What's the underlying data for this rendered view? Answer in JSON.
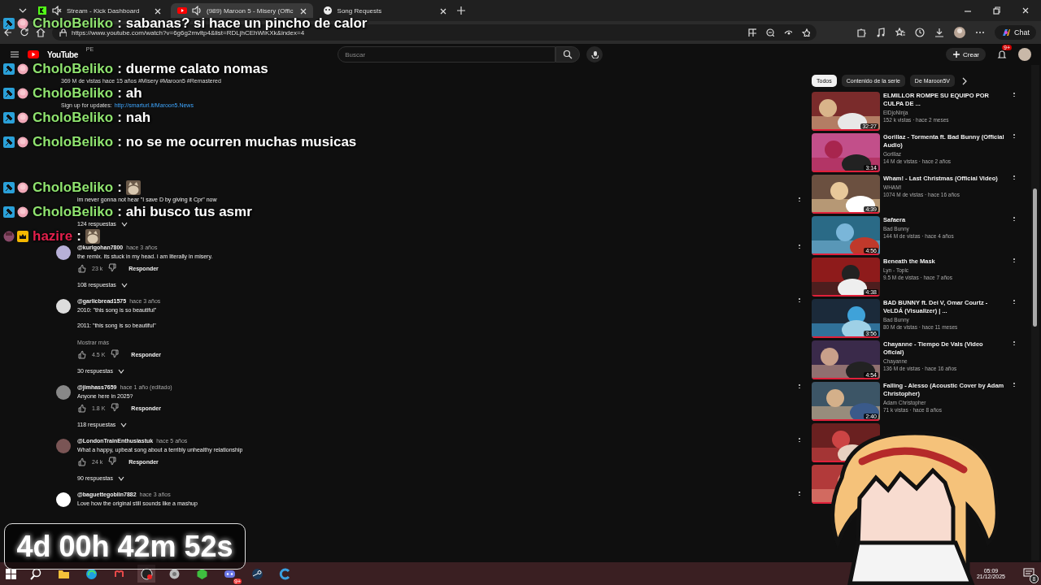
{
  "browser": {
    "tabs": [
      {
        "title": "Stream - Kick Dashboard",
        "kind": "kick",
        "audible": true,
        "muted": true,
        "selected": false
      },
      {
        "title": "(989) Maroon 5 - Misery (Offic",
        "kind": "youtube",
        "audible": true,
        "muted": false,
        "selected": true
      },
      {
        "title": "Song Requests",
        "kind": "bot",
        "audible": false,
        "selected": false
      }
    ],
    "url": "https://www.youtube.com/watch?v=6g6g2mvltp4&list=RDLjhCEhWiKXk&index=4",
    "chat_button": "Chat"
  },
  "youtube": {
    "logo": "YouTube",
    "region": "PE",
    "search_placeholder": "Buscar",
    "create": "Crear",
    "notifications": "9+",
    "description": {
      "meta": "369 M de vistas  hace 15 años  #Misery #Maroon5 #Remastered",
      "signup": "Sign up for updates:",
      "link": "http://smarturl.it/Maroon5.News"
    },
    "comments": [
      {
        "lines": [
          "im never gonna not hear \"I save D by giving it Cpr\" now"
        ],
        "replies": "124 respuestas"
      },
      {
        "author": "@kurigohan7800",
        "time": "hace 3 años",
        "lines": [
          "the remix. its stuck in my head. i am literally in misery."
        ],
        "likes": "23 k",
        "reply": "Responder",
        "replies": "108 respuestas"
      },
      {
        "author": "@garlicbread1575",
        "time": "hace 3 años",
        "lines": [
          "2010: \"this song is so beautiful\"",
          "2011: \"this song is so beautiful\""
        ],
        "more": "Mostrar más",
        "likes": "4.5 K",
        "reply": "Responder",
        "replies": "30 respuestas"
      },
      {
        "author": "@jimhass7659",
        "time": "hace 1 año (editado)",
        "lines": [
          "Anyone here in 2025?"
        ],
        "likes": "1.8 K",
        "reply": "Responder",
        "replies": "118 respuestas"
      },
      {
        "author": "@LondonTrainEnthusiastuk",
        "time": "hace 5 años",
        "lines": [
          "What a happy, upbeat song about a terribly unhealthy relationship"
        ],
        "likes": "24 k",
        "reply": "Responder",
        "replies": "90 respuestas"
      },
      {
        "author": "@baguettegoblin7882",
        "time": "hace 3 años",
        "lines": [
          "Love how the original still sounds like a mashup"
        ]
      }
    ],
    "chips": [
      {
        "label": "Todos",
        "selected": true
      },
      {
        "label": "Contenido de la serie",
        "selected": false
      },
      {
        "label": "De Maroon5V",
        "selected": false
      }
    ],
    "videos": [
      {
        "kind": "video",
        "title": "ELMILLOR ROMPE SU EQUIPO POR CULPA DE ...",
        "channel": "ElDjoNinja",
        "stats": "152 k vistas · hace 2 meses",
        "duration": "32:27"
      },
      {
        "kind": "video",
        "title": "Gorillaz - Tormenta ft. Bad Bunny (Official Audio)",
        "channel": "Gorillaz",
        "stats": "14 M de vistas · hace 2 años",
        "duration": "3:14"
      },
      {
        "kind": "video",
        "title": "Wham! - Last Christmas (Official Video)",
        "channel": "WHAM!",
        "stats": "1074 M de vistas · hace 16 años",
        "duration": "4:39"
      },
      {
        "kind": "video",
        "title": "Safaera",
        "channel": "Bad Bunny",
        "stats": "144 M de vistas · hace 4 años",
        "duration": "4:56"
      },
      {
        "kind": "video",
        "title": "Beneath the Mask",
        "channel": "Lyn - Topic",
        "stats": "9.5 M de vistas · hace 7 años",
        "duration": "4:38"
      },
      {
        "kind": "video",
        "title": "BAD BUNNY ft. Dei V, Omar Courtz - VeLDÁ (Visualizer) | ...",
        "channel": "Bad Bunny",
        "stats": "80 M de vistas · hace 11 meses",
        "duration": "3:56"
      },
      {
        "kind": "video",
        "title": "Chayanne - Tiempo De Vals (Video Oficial)",
        "channel": "Chayanne",
        "stats": "136 M de vistas · hace 16 años",
        "duration": "4:54"
      },
      {
        "kind": "video",
        "title": "Falling - Alesso (Acoustic Cover by Adam Christopher)",
        "channel": "Adam Christopher",
        "stats": "71 k vistas · hace 8 años",
        "duration": "2:40"
      },
      {
        "kind": "thumbnail"
      },
      {
        "kind": "thumbnail"
      }
    ]
  },
  "chat": [
    {
      "user": "CholoBeliko",
      "color": "#8fe36f",
      "moderator": true,
      "crown": false,
      "separator": ":",
      "message": "sabanas? si hace un pincho de calor"
    },
    {
      "user": "CholoBeliko",
      "color": "#8fe36f",
      "moderator": true,
      "crown": false,
      "separator": ":",
      "message": "duerme calato nomas"
    },
    {
      "user": "CholoBeliko",
      "color": "#8fe36f",
      "moderator": true,
      "crown": false,
      "separator": ":",
      "message": "ah"
    },
    {
      "user": "CholoBeliko",
      "color": "#8fe36f",
      "moderator": true,
      "crown": false,
      "separator": ":",
      "message": "nah"
    },
    {
      "user": "CholoBeliko",
      "color": "#8fe36f",
      "moderator": true,
      "crown": false,
      "separator": ":",
      "message": "no se me ocurren muchas musicas"
    },
    {
      "user": "CholoBeliko",
      "color": "#8fe36f",
      "moderator": true,
      "crown": false,
      "separator": ":",
      "emote": true
    },
    {
      "user": "CholoBeliko",
      "color": "#8fe36f",
      "moderator": true,
      "crown": false,
      "separator": ":",
      "message": "ahi busco tus asmr"
    },
    {
      "user": "hazire",
      "color": "#e3204c",
      "moderator": false,
      "crown": true,
      "separator": ":",
      "emote": true
    }
  ],
  "timer": "4d 00h 42m 52s",
  "taskbar": {
    "apps": [
      {
        "kind": "search"
      },
      {
        "kind": "folder"
      },
      {
        "kind": "edge"
      },
      {
        "kind": "m"
      },
      {
        "kind": "obs",
        "selected": true
      },
      {
        "kind": "gear"
      },
      {
        "kind": "hex"
      },
      {
        "kind": "discord",
        "badge": "9+"
      },
      {
        "kind": "steam"
      },
      {
        "kind": "cc"
      }
    ],
    "time": "05:09",
    "date": "21/12/2025",
    "notifications": "8"
  }
}
